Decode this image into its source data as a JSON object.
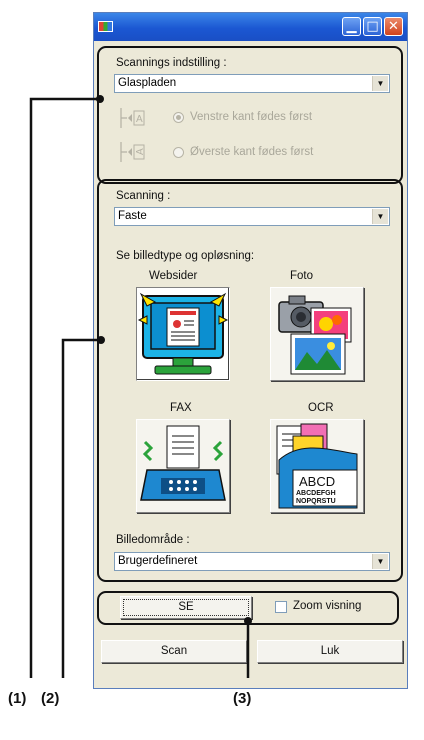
{
  "window": {
    "title": ""
  },
  "scan_setting": {
    "label": "Scannings indstilling :",
    "value": "Glaspladen",
    "option_1": "Venstre kant fødes først",
    "option_2": "Øverste kant fødes først"
  },
  "scanning": {
    "label": "Scanning :",
    "value": "Faste",
    "image_type_label": "Se billedtype og opløsning:",
    "buttons": {
      "web": "Websider",
      "photo": "Foto",
      "fax": "FAX",
      "ocr": "OCR"
    },
    "ocr_card_big": "ABCD",
    "ocr_card_line1": "ABCDEFGH",
    "ocr_card_line2": "NOPQRSTU",
    "area_label": "Billedområde :",
    "area_value": "Brugerdefineret"
  },
  "preview": {
    "button": "SE",
    "zoom_label": "Zoom visning"
  },
  "footer": {
    "scan_button": "Scan",
    "close_button": "Luk"
  },
  "annotations": {
    "a1": "(1)",
    "a2": "(2)",
    "a3": "(3)"
  }
}
